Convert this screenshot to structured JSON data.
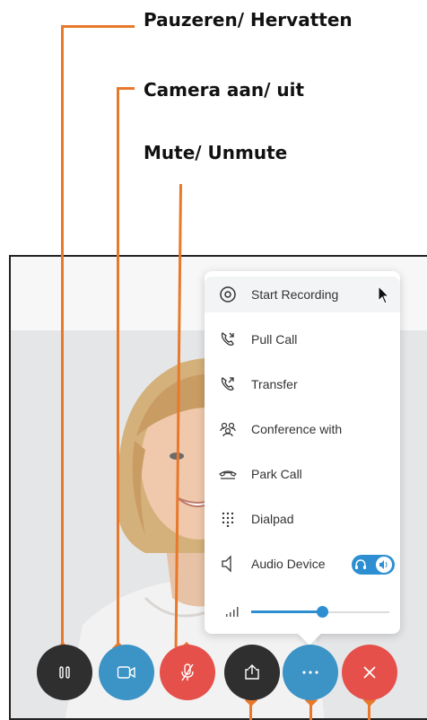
{
  "annotations": {
    "pause": "Pauzeren/ Hervatten",
    "camera": "Camera aan/ uit",
    "mute": "Mute/ Unmute"
  },
  "menu": {
    "items": [
      {
        "label": "Start Recording",
        "icon": "record-icon"
      },
      {
        "label": "Pull Call",
        "icon": "pull-call-icon"
      },
      {
        "label": "Transfer",
        "icon": "transfer-icon"
      },
      {
        "label": "Conference with",
        "icon": "conference-icon"
      },
      {
        "label": "Park Call",
        "icon": "park-call-icon"
      },
      {
        "label": "Dialpad",
        "icon": "dialpad-icon"
      },
      {
        "label": "Audio Device",
        "icon": "speaker-icon"
      }
    ],
    "volume_level": 0.51
  },
  "controls": [
    {
      "name": "pause",
      "icon": "pause-icon",
      "color": "#2f2f2f"
    },
    {
      "name": "camera",
      "icon": "video-camera-icon",
      "color": "#3b93c6"
    },
    {
      "name": "mute",
      "icon": "microphone-muted-icon",
      "color": "#e5504a"
    },
    {
      "name": "share",
      "icon": "share-upload-icon",
      "color": "#2f2f2f"
    },
    {
      "name": "more",
      "icon": "more-dots-icon",
      "color": "#3b93c6"
    },
    {
      "name": "end-call",
      "icon": "close-icon",
      "color": "#e5504a"
    }
  ],
  "colors": {
    "accent": "#e8792b",
    "toggle": "#2d8fd1",
    "slider": "#2d8fd1"
  }
}
